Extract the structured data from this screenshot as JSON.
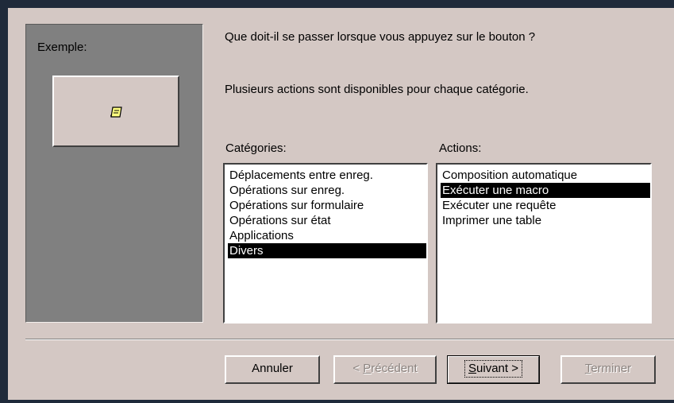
{
  "example": {
    "label": "Exemple:",
    "icon": "scroll-icon"
  },
  "prompt": "Que doit-il se passer lorsque vous appuyez sur le bouton ?",
  "hint": "Plusieurs actions sont disponibles pour chaque catégorie.",
  "categories": {
    "label": "Catégories:",
    "items": [
      "Déplacements entre enreg.",
      "Opérations sur enreg.",
      "Opérations sur formulaire",
      "Opérations sur état",
      "Applications",
      "Divers"
    ],
    "selected": "Divers"
  },
  "actions": {
    "label": "Actions:",
    "items": [
      "Composition automatique",
      "Exécuter une macro",
      "Exécuter une requête",
      "Imprimer une table"
    ],
    "selected": "Exécuter une macro"
  },
  "buttons": {
    "cancel": "Annuler",
    "previous_prefix": "< ",
    "previous_accel": "P",
    "previous_rest": "récédent",
    "next_accel": "S",
    "next_rest": "uivant >",
    "finish_accel": "T",
    "finish_rest": "erminer"
  },
  "colors": {
    "selection_bg": "#000000",
    "selection_fg": "#ffffff",
    "dialog_bg": "#d4c8c4",
    "panel_bg": "#808080"
  }
}
